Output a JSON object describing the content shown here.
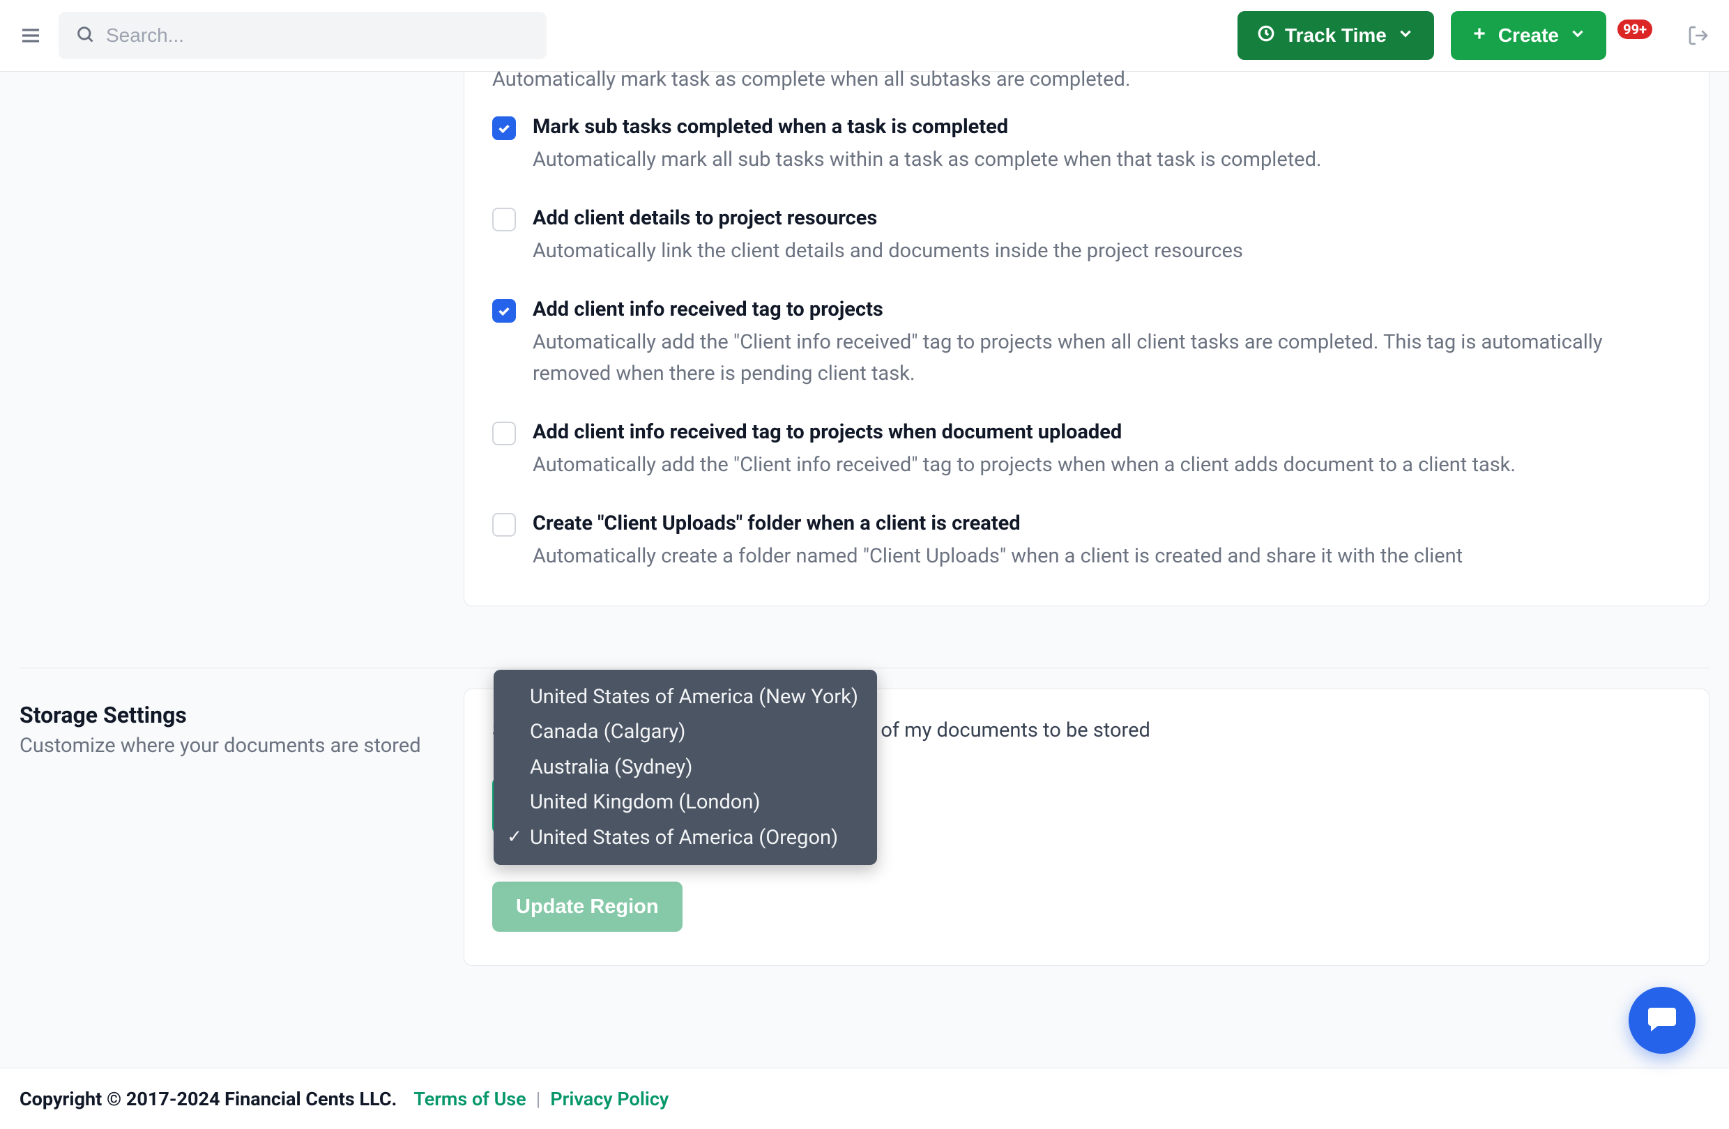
{
  "header": {
    "search_placeholder": "Search...",
    "track_label": "Track Time",
    "create_label": "Create",
    "notification_count": "99+"
  },
  "automations_card": {
    "cutoff_desc": "Automatically mark task as complete when all subtasks are completed.",
    "settings": [
      {
        "checked": true,
        "title": "Mark sub tasks completed when a task is completed",
        "desc": "Automatically mark all sub tasks within a task as complete when that task is completed."
      },
      {
        "checked": false,
        "title": "Add client details to project resources",
        "desc": "Automatically link the client details and documents inside the project resources"
      },
      {
        "checked": true,
        "title": "Add client info received tag to projects",
        "desc": "Automatically add the \"Client info received\" tag to projects when all client tasks are completed. This tag is automatically removed when there is pending client task."
      },
      {
        "checked": false,
        "title": "Add client info received tag to projects when document uploaded",
        "desc": "Automatically add the \"Client info received\" tag to projects when when a client adds document to a client task."
      },
      {
        "checked": false,
        "title": "Create \"Client Uploads\" folder when a client is created",
        "desc": "Automatically create a folder named \"Client Uploads\" when a client is created and share it with the client"
      }
    ]
  },
  "storage": {
    "title": "Storage Settings",
    "subtitle": "Customize where your documents are stored",
    "prompt_hidden_part": "Select the location where you would like all of my documents to be stored",
    "update_button": "Update Region",
    "selected_region": "United States of America (Oregon)",
    "options": [
      {
        "label": "United States of America (New York)",
        "selected": false
      },
      {
        "label": "Canada (Calgary)",
        "selected": false
      },
      {
        "label": "Australia (Sydney)",
        "selected": false
      },
      {
        "label": "United Kingdom (London)",
        "selected": false
      },
      {
        "label": "United States of America (Oregon)",
        "selected": true
      }
    ]
  },
  "footer": {
    "copyright": "Copyright © 2017-2024 Financial Cents LLC.",
    "terms": "Terms of Use",
    "privacy": "Privacy Policy",
    "separator": "|"
  }
}
